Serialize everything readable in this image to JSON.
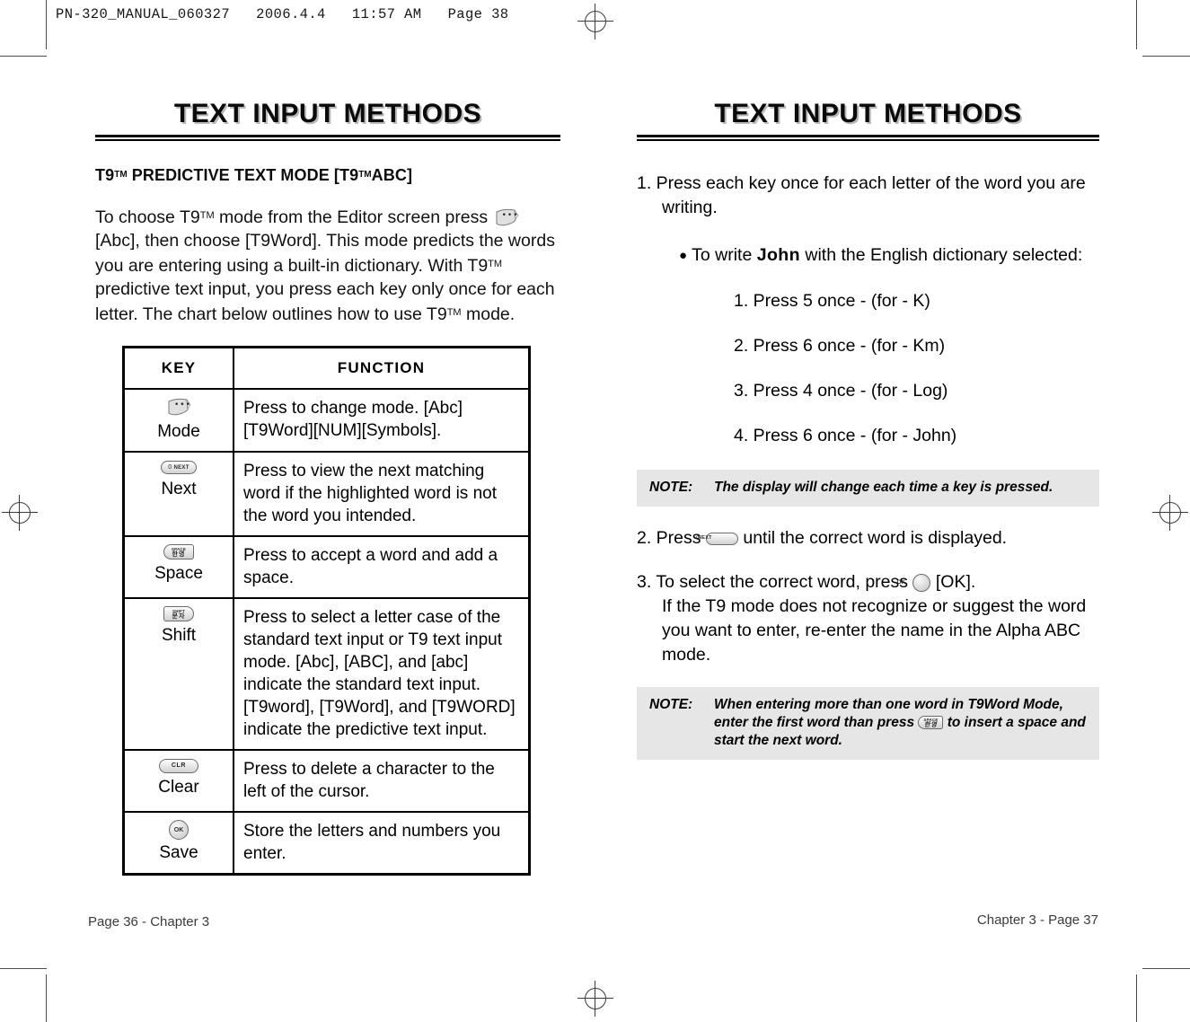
{
  "print_slug": "PN-320_MANUAL_060327   2006.4.4   11:57 AM   Page 38",
  "left_page": {
    "chapter_title": "TEXT INPUT METHODS",
    "subhead": {
      "part1": "T9",
      "tm1": "TM",
      "part2": " PREDICTIVE TEXT MODE [T9",
      "tm2": "TM",
      "part3": "ABC]"
    },
    "intro": {
      "s1": "To choose T9",
      "tm1": "TM",
      "s2": " mode from the Editor screen press ",
      "icon": "mode-key-icon",
      "s3": " [Abc], then choose [T9Word].  This mode predicts the words you are entering using a built-in dictionary. With T9",
      "tm2": "TM",
      "s4": " predictive text input, you press each key only once for each letter. The chart below outlines how to use T9",
      "tm3": "TM",
      "s5": " mode."
    },
    "table": {
      "headers": [
        "KEY",
        "FUNCTION"
      ],
      "rows": [
        {
          "key_icon": "mode-key-icon",
          "key_label": "Mode",
          "function": "Press to change mode. [Abc][T9Word][NUM][Symbols]."
        },
        {
          "key_icon": "next-key-icon",
          "key_glyph_top": "0",
          "key_glyph_main": "NEXT",
          "key_label": "Next",
          "function": "Press to view the next matching word if the highlighted word is not the word you intended."
        },
        {
          "key_icon": "space-key-icon",
          "key_glyph_top": "SPACE",
          "key_glyph_main": "한영",
          "key_label": "Space",
          "function": "Press to accept a word and add a space."
        },
        {
          "key_icon": "shift-key-icon",
          "key_glyph_top": "SHIFT",
          "key_glyph_main": "문자",
          "key_label": "Shift",
          "function": "Press to select a letter case of the standard text input or T9 text input mode. [Abc], [ABC], and [abc] indicate the standard text input. [T9word], [T9Word], and [T9WORD] indicate the predictive text input."
        },
        {
          "key_icon": "clear-key-icon",
          "key_glyph_main": "CLR",
          "key_label": "Clear",
          "function": "Press to delete a character to the left of the cursor."
        },
        {
          "key_icon": "ok-key-icon",
          "key_glyph_main": "OK",
          "key_label": "Save",
          "function": "Store the letters and numbers you enter."
        }
      ]
    },
    "footer": "Page 36 - Chapter 3"
  },
  "right_page": {
    "chapter_title": "TEXT INPUT METHODS",
    "step1": "1. Press each key once for each letter of the word you are writing.",
    "bullet": {
      "pre": "To write ",
      "bold": "John",
      "post": " with the English dictionary selected:"
    },
    "sub_steps": [
      "1. Press 5 once - (for - K)",
      "2. Press 6 once - (for - Km)",
      "3. Press 4 once - (for - Log)",
      "4. Press 6 once - (for - John)"
    ],
    "note1": {
      "label": "NOTE:",
      "text": "The display will change each time a key is pressed."
    },
    "step2": {
      "pre": "2. Press ",
      "icon": "next-key-icon",
      "post": " until the correct word is displayed."
    },
    "step3": {
      "pre": "3. To select the correct word, press ",
      "icon": "ok-key-icon",
      "post": " [OK].",
      "cont": "If the T9 mode does not recognize or suggest the word you want to enter, re-enter the name in the Alpha ABC mode."
    },
    "note2": {
      "label": "NOTE:",
      "pre": "When entering more than one word in T9Word Mode, enter the first word than press ",
      "icon": "space-key-icon",
      "post": " to insert a space and start the next word."
    },
    "footer": "Chapter 3 - Page 37"
  },
  "colors": {
    "note_background": "#e6e6e6",
    "title_shadow": "#b9b9b9",
    "ink": "#000000"
  }
}
